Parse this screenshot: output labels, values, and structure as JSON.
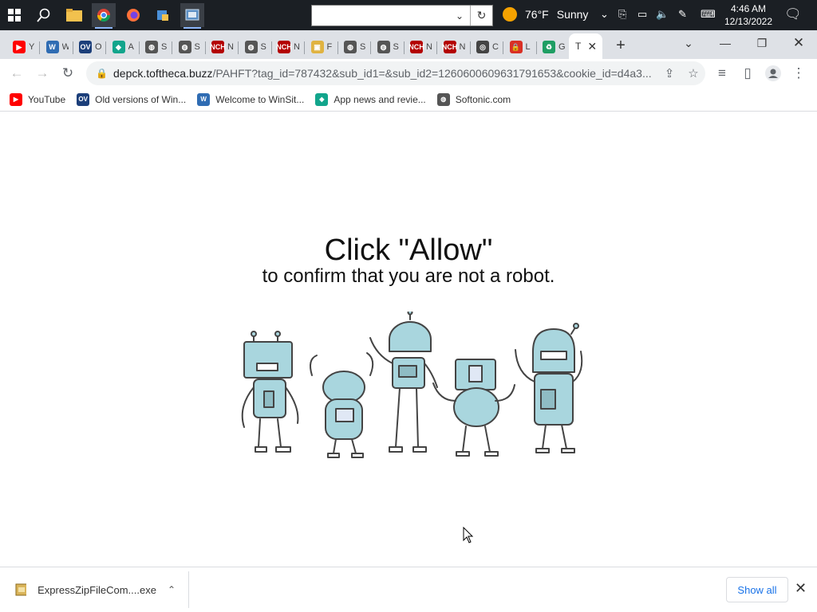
{
  "taskbar": {
    "search_value": "",
    "weather": {
      "temp": "76°F",
      "condition": "Sunny"
    },
    "clock": {
      "time": "4:46 AM",
      "date": "12/13/2022"
    }
  },
  "tabs": [
    {
      "title": "Y",
      "favicon": "youtube-icon",
      "color": "#ff0000",
      "glyph": "▶"
    },
    {
      "title": "W",
      "favicon": "winsite-icon",
      "color": "#2f6cb3",
      "glyph": "W"
    },
    {
      "title": "O",
      "favicon": "oldversion-icon",
      "color": "#1c3f7a",
      "glyph": "OV"
    },
    {
      "title": "A",
      "favicon": "appnews-icon",
      "color": "#12a58c",
      "glyph": "◆"
    },
    {
      "title": "S",
      "favicon": "globe-icon",
      "color": "#555555",
      "glyph": "◍"
    },
    {
      "title": "S",
      "favicon": "globe-icon",
      "color": "#555555",
      "glyph": "◍"
    },
    {
      "title": "N",
      "favicon": "nch-icon",
      "color": "#b30000",
      "glyph": "NCH"
    },
    {
      "title": "S",
      "favicon": "globe-icon",
      "color": "#555555",
      "glyph": "◍"
    },
    {
      "title": "N",
      "favicon": "nch-icon",
      "color": "#b30000",
      "glyph": "NCH"
    },
    {
      "title": "F",
      "favicon": "folder-icon",
      "color": "#e0b341",
      "glyph": "▣"
    },
    {
      "title": "S",
      "favicon": "globe-icon",
      "color": "#555555",
      "glyph": "◍"
    },
    {
      "title": "S",
      "favicon": "globe-icon",
      "color": "#555555",
      "glyph": "◍"
    },
    {
      "title": "N",
      "favicon": "nch-icon",
      "color": "#b30000",
      "glyph": "NCH"
    },
    {
      "title": "N",
      "favicon": "nch-icon",
      "color": "#b30000",
      "glyph": "NCH"
    },
    {
      "title": "C",
      "favicon": "chrome-icon",
      "color": "#444444",
      "glyph": "◎"
    },
    {
      "title": "L",
      "favicon": "lock-icon",
      "color": "#d93025",
      "glyph": "🔒"
    },
    {
      "title": "G",
      "favicon": "recycle-icon",
      "color": "#1e9e63",
      "glyph": "♻"
    }
  ],
  "active_tab": {
    "title": "T"
  },
  "address": {
    "host": "depck.toftheca.buzz",
    "path": "/PAHFT?tag_id=787432&sub_id1=&sub_id2=1260600609631791653&cookie_id=d4a3..."
  },
  "bookmarks": [
    {
      "label": "YouTube",
      "icon": "youtube-icon",
      "color": "#ff0000",
      "glyph": "▶"
    },
    {
      "label": "Old versions of Win...",
      "icon": "oldversion-icon",
      "color": "#1c3f7a",
      "glyph": "OV"
    },
    {
      "label": "Welcome to WinSit...",
      "icon": "winsite-icon",
      "color": "#2f6cb3",
      "glyph": "W"
    },
    {
      "label": "App news and revie...",
      "icon": "appnews-icon",
      "color": "#12a58c",
      "glyph": "◆"
    },
    {
      "label": "Softonic.com",
      "icon": "globe-icon",
      "color": "#555555",
      "glyph": "◍"
    }
  ],
  "page": {
    "heading": "Click \"Allow\"",
    "subheading": "to confirm that you are not a robot."
  },
  "download": {
    "filename": "ExpressZipFileCom....exe",
    "show_all": "Show all"
  },
  "colors": {
    "robot_fill": "#a9d6de",
    "robot_stroke": "#444444",
    "accent": "#1a73e8"
  }
}
